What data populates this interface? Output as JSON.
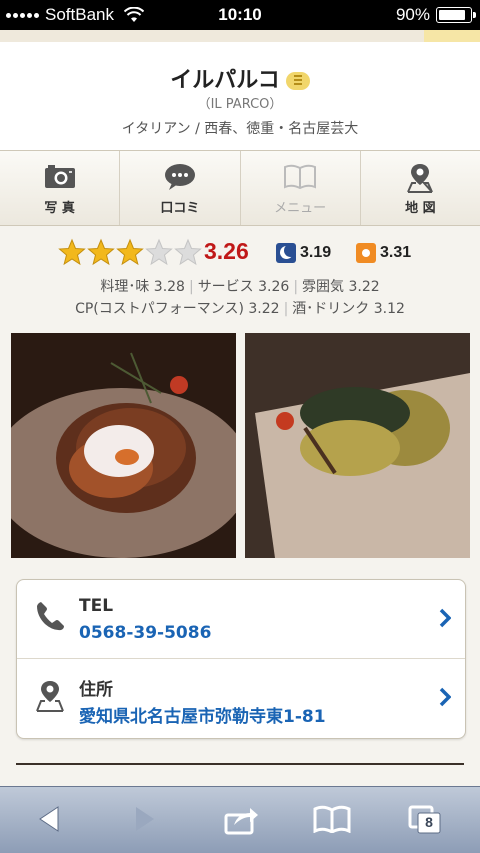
{
  "status_bar": {
    "carrier": "SoftBank",
    "time": "10:10",
    "battery": "90%"
  },
  "header": {
    "shop_name": "イルパルコ",
    "shop_name_roman": "（IL PARCO）",
    "genre_area": "イタリアン / 西春、徳重・名古屋芸大"
  },
  "tabs": [
    {
      "label": "写 真",
      "icon": "camera-icon",
      "enabled": true
    },
    {
      "label": "口コミ",
      "icon": "comment-bubble-icon",
      "enabled": true
    },
    {
      "label": "メニュー",
      "icon": "book-icon",
      "enabled": false
    },
    {
      "label": "地 図",
      "icon": "map-pin-icon",
      "enabled": true
    }
  ],
  "rating": {
    "stars": 3,
    "overall": "3.26",
    "dinner": "3.19",
    "lunch": "3.31",
    "line1": {
      "taste": "料理･味 3.28",
      "service": "サービス 3.26",
      "atmosphere": "雰囲気 3.22"
    },
    "line2": {
      "cp": "CP(コストパフォーマンス) 3.22",
      "drink": "酒･ドリンク 3.12"
    },
    "colors": {
      "score": "#c01818",
      "star": "#f2b81c",
      "dinner_badge": "#2a4f93",
      "lunch_badge": "#f08b23"
    }
  },
  "photos": [
    {
      "subject": "food-photo"
    },
    {
      "subject": "food-photo"
    }
  ],
  "contact": {
    "tel_label": "TEL",
    "tel_value": "0568-39-5086",
    "address_label": "住所",
    "address_value": "愛知県北名古屋市弥勒寺東1-81",
    "link_color": "#1a64b4"
  },
  "browser_toolbar": {
    "tabs_count": "8"
  }
}
